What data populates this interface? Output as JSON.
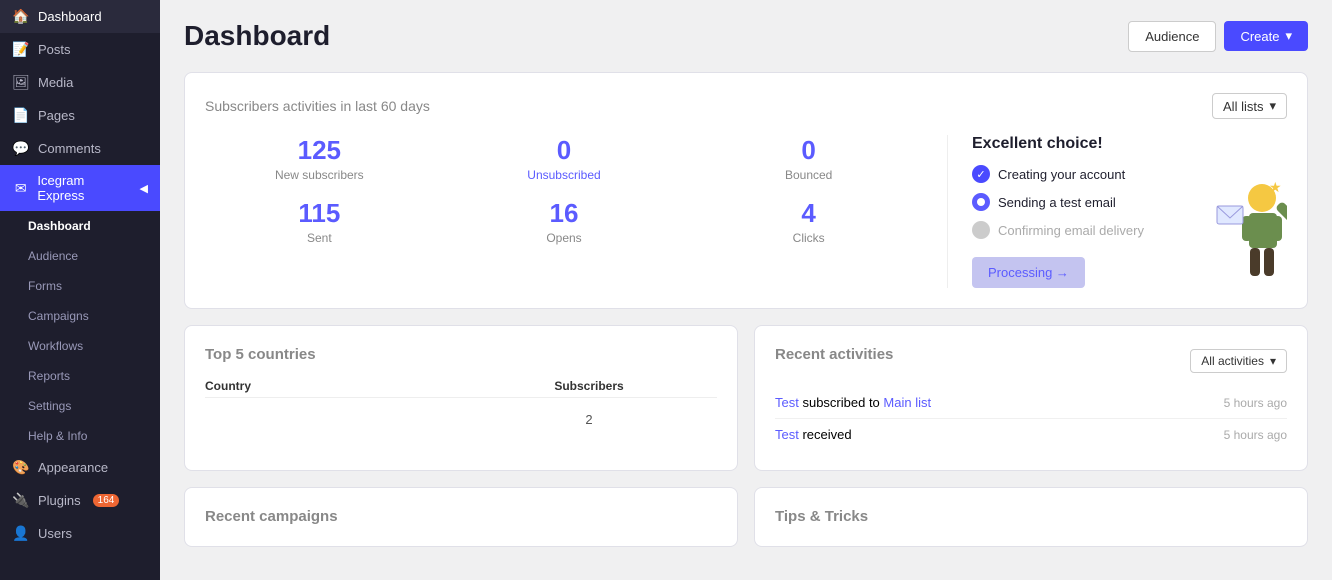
{
  "sidebar": {
    "items": [
      {
        "label": "Dashboard",
        "icon": "🏠",
        "id": "dashboard"
      },
      {
        "label": "Posts",
        "icon": "📝",
        "id": "posts"
      },
      {
        "label": "Media",
        "icon": "🖼",
        "id": "media"
      },
      {
        "label": "Pages",
        "icon": "📄",
        "id": "pages"
      },
      {
        "label": "Comments",
        "icon": "💬",
        "id": "comments"
      },
      {
        "label": "Icegram Express",
        "icon": "✉",
        "id": "icegram",
        "highlight": true
      },
      {
        "label": "Dashboard",
        "icon": "",
        "id": "ig-dashboard",
        "sub": true,
        "active": true
      },
      {
        "label": "Audience",
        "icon": "",
        "id": "ig-audience",
        "sub": true
      },
      {
        "label": "Forms",
        "icon": "",
        "id": "ig-forms",
        "sub": true
      },
      {
        "label": "Campaigns",
        "icon": "",
        "id": "ig-campaigns",
        "sub": true
      },
      {
        "label": "Workflows",
        "icon": "",
        "id": "ig-workflows",
        "sub": true
      },
      {
        "label": "Reports",
        "icon": "",
        "id": "ig-reports",
        "sub": true
      },
      {
        "label": "Settings",
        "icon": "",
        "id": "ig-settings",
        "sub": true
      },
      {
        "label": "Help & Info",
        "icon": "",
        "id": "ig-help",
        "sub": true
      },
      {
        "label": "Appearance",
        "icon": "🎨",
        "id": "appearance"
      },
      {
        "label": "Plugins",
        "icon": "🔌",
        "id": "plugins",
        "badge": "164"
      },
      {
        "label": "Users",
        "icon": "👤",
        "id": "users"
      }
    ]
  },
  "page": {
    "title": "Dashboard",
    "audience_btn": "Audience",
    "create_btn": "Create",
    "create_icon": "▾"
  },
  "activity_section": {
    "title": "Subscribers activities in last 60 days",
    "filter_label": "All lists",
    "filter_icon": "▾",
    "stats": [
      {
        "number": "125",
        "label": "New subscribers"
      },
      {
        "number": "0",
        "label": "Unsubscribed",
        "style": "unsubscribed"
      },
      {
        "number": "0",
        "label": "Bounced"
      },
      {
        "number": "115",
        "label": "Sent"
      },
      {
        "number": "16",
        "label": "Opens"
      },
      {
        "number": "4",
        "label": "Clicks"
      }
    ]
  },
  "checklist": {
    "title": "Excellent choice!",
    "items": [
      {
        "text": "Creating your account",
        "status": "done"
      },
      {
        "text": "Sending a test email",
        "status": "progress"
      },
      {
        "text": "Confirming email delivery",
        "status": "pending"
      }
    ],
    "processing_btn": "Processing →",
    "figure": "🧑‍💼"
  },
  "countries": {
    "title": "Top 5 countries",
    "col1": "Country",
    "col2": "Subscribers",
    "rows": [
      {
        "country": "",
        "subscribers": "2"
      }
    ]
  },
  "activities": {
    "title": "Recent activities",
    "filter_label": "All activities",
    "filter_icon": "▾",
    "items": [
      {
        "text_parts": [
          "Test",
          " subscribed to ",
          "Main list"
        ],
        "time": "5 hours ago",
        "link1": true,
        "link2": true
      },
      {
        "text_parts": [
          "Test",
          " received"
        ],
        "time": "5 hours ago",
        "link1": true,
        "link2": false
      }
    ]
  },
  "recent_campaigns": {
    "title": "Recent campaigns"
  },
  "tips": {
    "title": "Tips & Tricks"
  }
}
